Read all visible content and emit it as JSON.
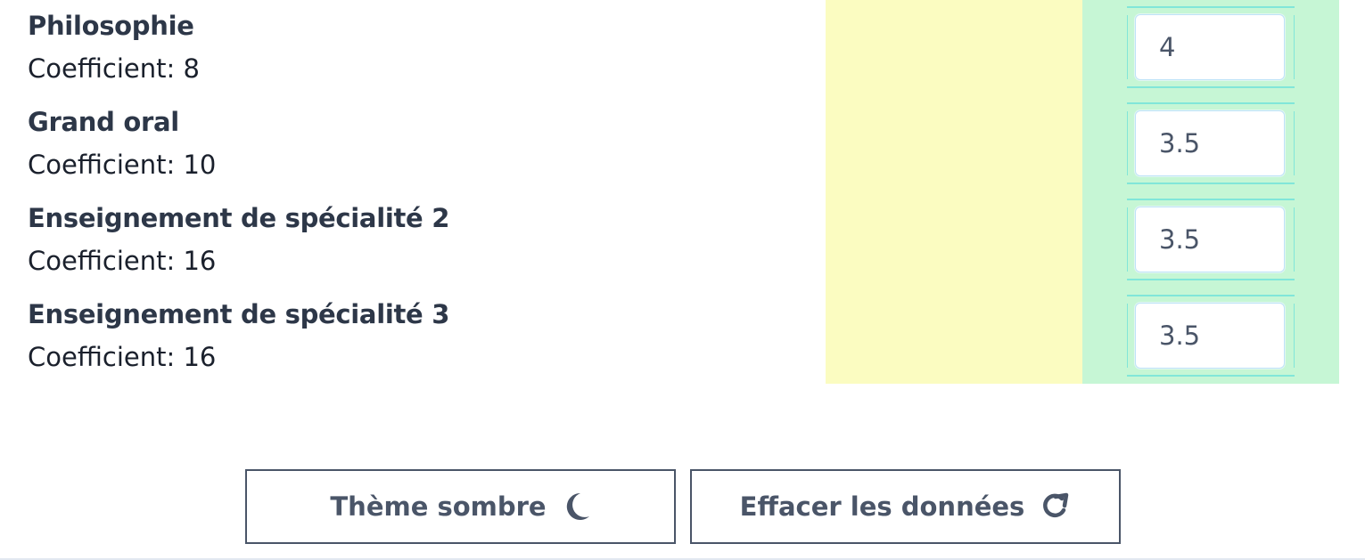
{
  "subjects": [
    {
      "name": "Philosophie",
      "coefficient_label": "Coefficient: 8",
      "grade": "4"
    },
    {
      "name": "Grand oral",
      "coefficient_label": "Coefficient: 10",
      "grade": "3.5"
    },
    {
      "name": "Enseignement de spécialité 2",
      "coefficient_label": "Coefficient: 16",
      "grade": "3.5"
    },
    {
      "name": "Enseignement de spécialité 3",
      "coefficient_label": "Coefficient: 16",
      "grade": "3.5"
    }
  ],
  "buttons": {
    "dark_theme_label": "Thème sombre",
    "dark_theme_icon": "moon-icon",
    "clear_data_label": "Effacer les données",
    "clear_data_icon": "refresh-icon"
  },
  "colors": {
    "yellow_column": "#fbfcc1",
    "green_column": "#c6f6d5",
    "text": "#2d3748",
    "button_border": "#4a5568"
  }
}
